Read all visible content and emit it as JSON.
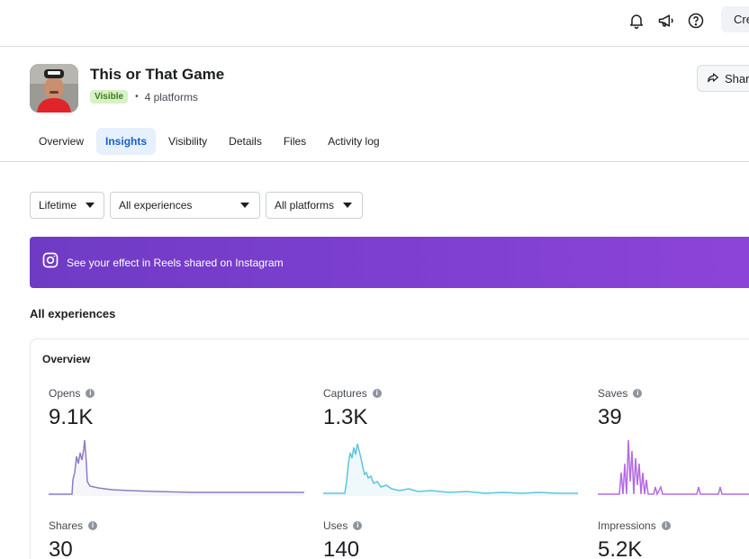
{
  "topbar": {
    "icons": [
      "bell-icon",
      "megaphone-icon",
      "help-icon"
    ],
    "create_label": "Cre"
  },
  "header": {
    "title": "This or That Game",
    "status_badge": "Visible",
    "separator": "•",
    "platforms": "4 platforms",
    "share_label": "Share"
  },
  "tabs": [
    {
      "label": "Overview",
      "active": false
    },
    {
      "label": "Insights",
      "active": true
    },
    {
      "label": "Visibility",
      "active": false
    },
    {
      "label": "Details",
      "active": false
    },
    {
      "label": "Files",
      "active": false
    },
    {
      "label": "Activity log",
      "active": false
    }
  ],
  "filters": {
    "time": "Lifetime",
    "experience": "All experiences",
    "platform": "All platforms"
  },
  "banner": {
    "text": "See your effect in Reels shared on Instagram",
    "icon": "instagram-icon"
  },
  "section_title": "All experiences",
  "overview": {
    "title": "Overview",
    "metrics": [
      {
        "label": "Opens",
        "value": "9.1K",
        "color": "#8e7cc3"
      },
      {
        "label": "Captures",
        "value": "1.3K",
        "color": "#5ec3e0"
      },
      {
        "label": "Saves",
        "value": "39",
        "color": "#b46be3"
      },
      {
        "label": "Shares",
        "value": "30"
      },
      {
        "label": "Uses",
        "value": "140"
      },
      {
        "label": "Impressions",
        "value": "5.2K"
      }
    ]
  },
  "colors": {
    "accent": "#1b5fc6",
    "banner_start": "#6f3bc4",
    "banner_end": "#8d44d8",
    "badge_bg": "#d7f2c4"
  }
}
